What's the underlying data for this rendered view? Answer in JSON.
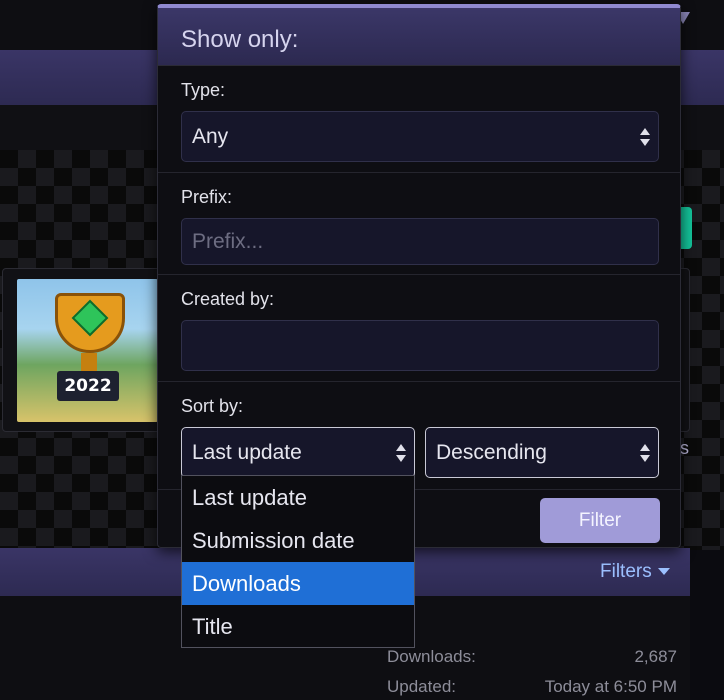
{
  "popup": {
    "title": "Show only:",
    "type": {
      "label": "Type:",
      "value": "Any"
    },
    "prefix": {
      "label": "Prefix:",
      "placeholder": "Prefix..."
    },
    "created_by": {
      "label": "Created by:",
      "value": ""
    },
    "sort": {
      "label": "Sort by:",
      "field_value": "Last update",
      "order_value": "Descending",
      "options": [
        "Last update",
        "Submission date",
        "Downloads",
        "Title"
      ],
      "highlighted_index": 2
    },
    "filter_button": "Filter"
  },
  "thumbnail": {
    "badge_text": "2022"
  },
  "list_header": {
    "filters_label": "Filters"
  },
  "stats": {
    "downloads_label": "Downloads:",
    "downloads_value": "2,687",
    "updated_label": "Updated:",
    "updated_value": "Today at 6:50 PM"
  },
  "background_fragment": "s",
  "colors": {
    "accent": "#a09bd8",
    "header": "#3a3566",
    "highlight": "#1f6fd6",
    "green": "#14c39a"
  }
}
